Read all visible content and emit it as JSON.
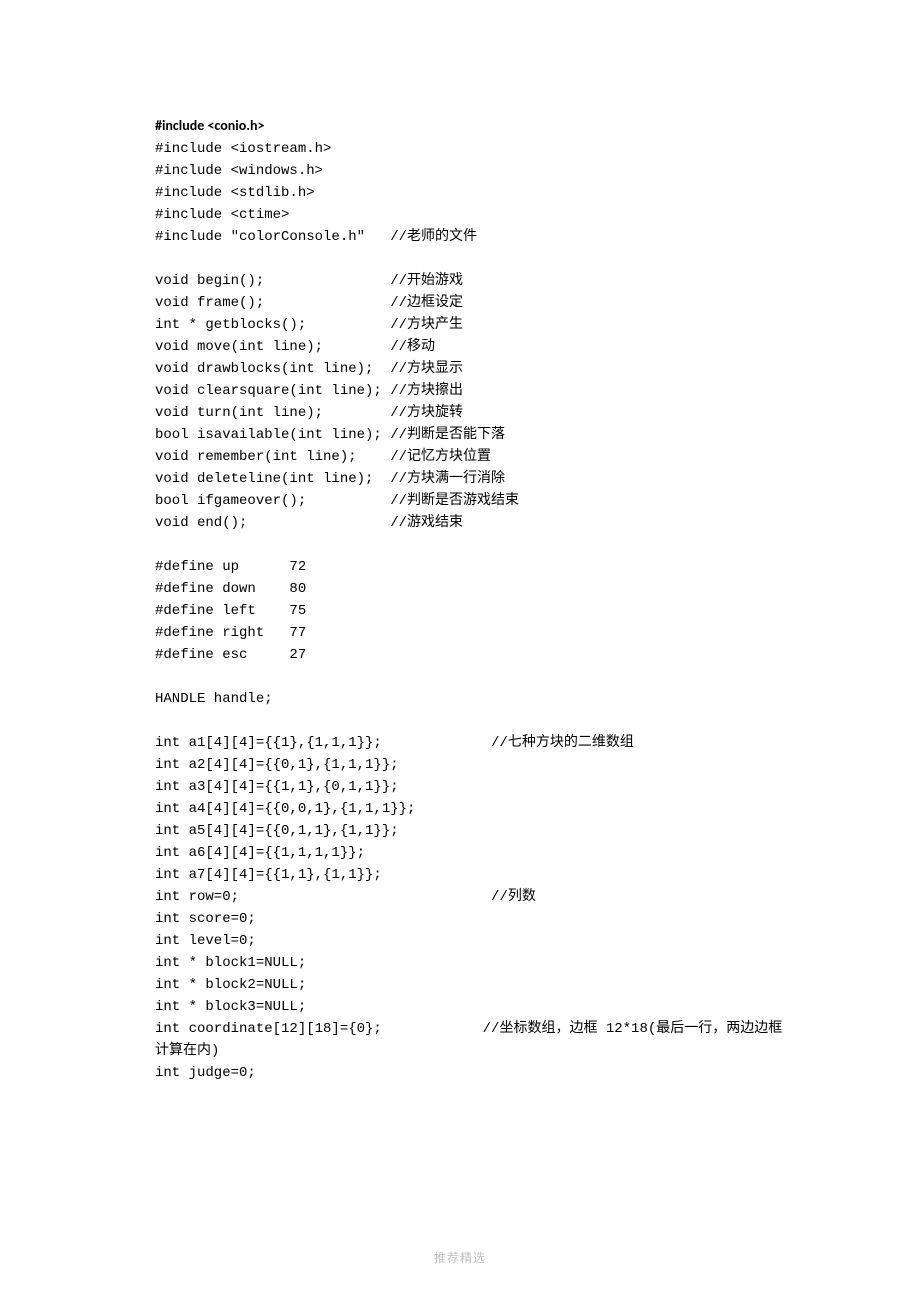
{
  "lines": [
    {
      "bold": "#include <conio.h>",
      "rest": ""
    },
    {
      "text": "#include <iostream.h>"
    },
    {
      "text": "#include <windows.h>"
    },
    {
      "text": "#include <stdlib.h>"
    },
    {
      "text": "#include <ctime>"
    },
    {
      "text": "#include \"colorConsole.h\"   //老师的文件"
    },
    {
      "text": ""
    },
    {
      "text": "void begin();               //开始游戏"
    },
    {
      "text": "void frame();               //边框设定"
    },
    {
      "text": "int * getblocks();          //方块产生"
    },
    {
      "text": "void move(int line);        //移动"
    },
    {
      "text": "void drawblocks(int line);  //方块显示"
    },
    {
      "text": "void clearsquare(int line); //方块擦出"
    },
    {
      "text": "void turn(int line);        //方块旋转"
    },
    {
      "text": "bool isavailable(int line); //判断是否能下落"
    },
    {
      "text": "void remember(int line);    //记忆方块位置"
    },
    {
      "text": "void deleteline(int line);  //方块满一行消除"
    },
    {
      "text": "bool ifgameover();          //判断是否游戏结束"
    },
    {
      "text": "void end();                 //游戏结束"
    },
    {
      "text": ""
    },
    {
      "text": "#define up      72"
    },
    {
      "text": "#define down    80"
    },
    {
      "text": "#define left    75"
    },
    {
      "text": "#define right   77"
    },
    {
      "text": "#define esc     27"
    },
    {
      "text": ""
    },
    {
      "text": "HANDLE handle;"
    },
    {
      "text": ""
    },
    {
      "text": "int a1[4][4]={{1},{1,1,1}};             //七种方块的二维数组"
    },
    {
      "text": "int a2[4][4]={{0,1},{1,1,1}};"
    },
    {
      "text": "int a3[4][4]={{1,1},{0,1,1}};"
    },
    {
      "text": "int a4[4][4]={{0,0,1},{1,1,1}};"
    },
    {
      "text": "int a5[4][4]={{0,1,1},{1,1}};"
    },
    {
      "text": "int a6[4][4]={{1,1,1,1}};"
    },
    {
      "text": "int a7[4][4]={{1,1},{1,1}};"
    },
    {
      "text": "int row=0;                              //列数"
    },
    {
      "text": "int score=0;"
    },
    {
      "text": "int level=0;"
    },
    {
      "text": "int * block1=NULL;"
    },
    {
      "text": "int * block2=NULL;"
    },
    {
      "text": "int * block3=NULL;"
    },
    {
      "text": "int coordinate[12][18]={0};            //坐标数组，边框 12*18(最后一行，两边边框"
    },
    {
      "text": "计算在内)"
    },
    {
      "text": "int judge=0;"
    }
  ],
  "footer": "推荐精选"
}
